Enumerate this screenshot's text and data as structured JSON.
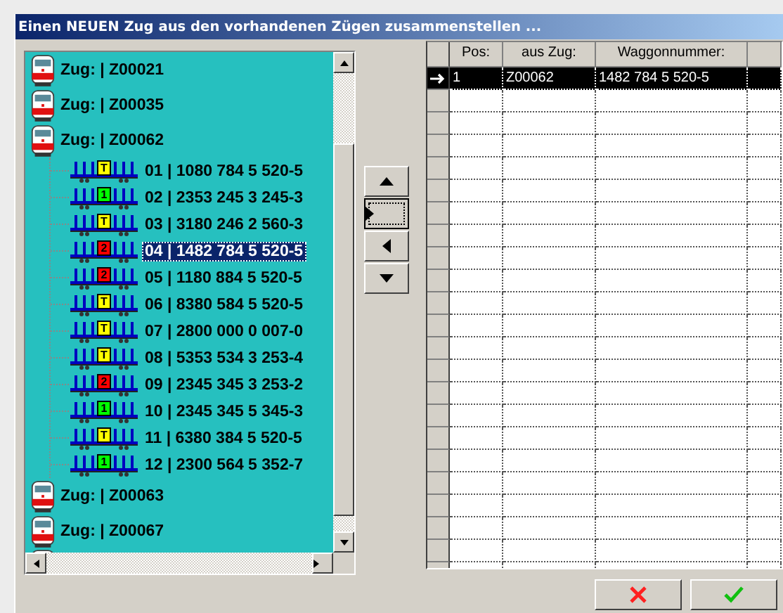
{
  "window": {
    "title": "Einen NEUEN Zug aus den vorhandenen Zügen zusammenstellen ..."
  },
  "tree": [
    {
      "label": "Zug: | Z00021"
    },
    {
      "label": "Zug: | Z00035"
    },
    {
      "label": "Zug: | Z00062",
      "children": [
        {
          "label": "01 | 1080 784 5 520-5",
          "tag": "T",
          "color": "#ffff00",
          "selected": false
        },
        {
          "label": "02 | 2353 245 3 245-3",
          "tag": "1",
          "color": "#00ff00",
          "selected": false
        },
        {
          "label": "03 | 3180 246 2 560-3",
          "tag": "T",
          "color": "#ffff00",
          "selected": false
        },
        {
          "label": "04 | 1482 784 5 520-5",
          "tag": "2",
          "color": "#ff0000",
          "selected": true
        },
        {
          "label": "05 | 1180 884 5 520-5",
          "tag": "2",
          "color": "#ff0000",
          "selected": false
        },
        {
          "label": "06 | 8380 584 5 520-5",
          "tag": "T",
          "color": "#ffff00",
          "selected": false
        },
        {
          "label": "07 | 2800 000 0 007-0",
          "tag": "T",
          "color": "#ffff00",
          "selected": false
        },
        {
          "label": "08 | 5353 534 3 253-4",
          "tag": "T",
          "color": "#ffff00",
          "selected": false
        },
        {
          "label": "09 | 2345 345 3 253-2",
          "tag": "2",
          "color": "#ff0000",
          "selected": false
        },
        {
          "label": "10 | 2345 345 5 345-3",
          "tag": "1",
          "color": "#00ff00",
          "selected": false
        },
        {
          "label": "11 | 6380 384 5 520-5",
          "tag": "T",
          "color": "#ffff00",
          "selected": false
        },
        {
          "label": "12 | 2300 564 5 352-7",
          "tag": "1",
          "color": "#00ff00",
          "selected": false
        }
      ]
    },
    {
      "label": "Zug: | Z00063"
    },
    {
      "label": "Zug: | Z00067"
    }
  ],
  "move_buttons": [
    {
      "kind": "up"
    },
    {
      "kind": "right",
      "focused": true
    },
    {
      "kind": "left",
      "focused": false
    },
    {
      "kind": "down"
    }
  ],
  "table": {
    "columns": [
      "Pos:",
      "aus Zug:",
      "Waggonnummer:"
    ],
    "rows": [
      {
        "cells": [
          "1",
          "Z00062",
          "1482 784 5 520-5"
        ],
        "selected": true
      }
    ]
  },
  "buttons": [
    {
      "kind": "cancel"
    },
    {
      "kind": "ok"
    }
  ]
}
